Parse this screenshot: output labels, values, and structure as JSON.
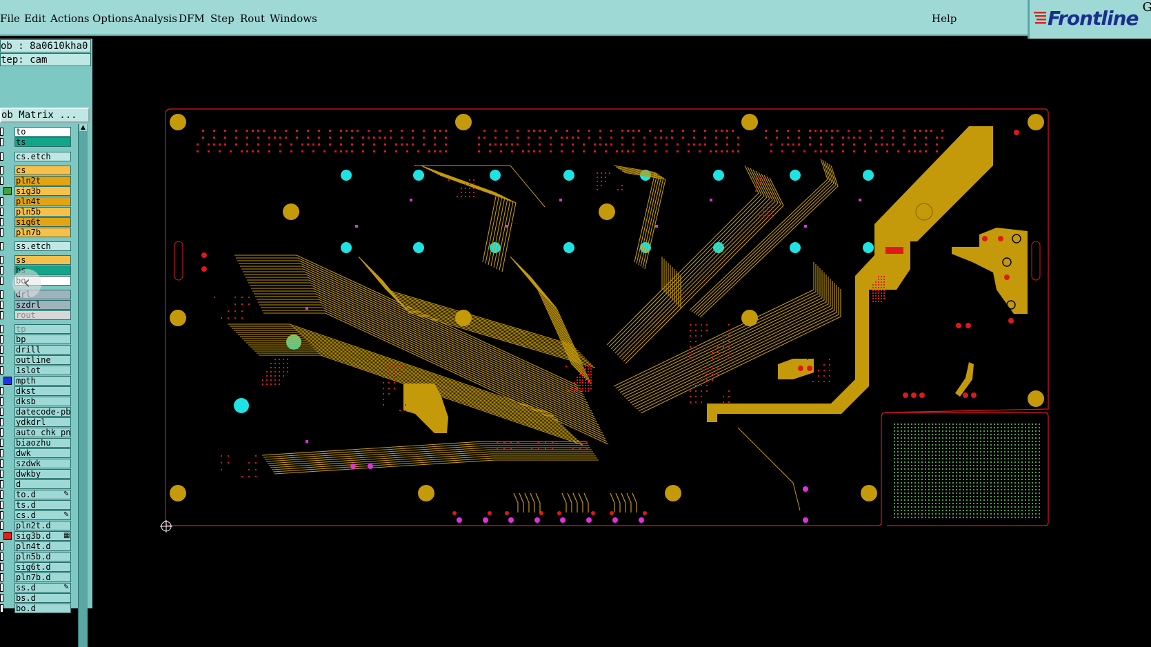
{
  "menubar": {
    "items": [
      "File",
      "Edit",
      "Actions",
      "Options",
      "Analysis",
      "DFM",
      "Step",
      "Rout",
      "Windows"
    ],
    "help": "Help"
  },
  "logo": {
    "text": "Frontline",
    "corner_letter": "G"
  },
  "job": {
    "job_line": "ob : 8a0610kha0",
    "step_line": "tep: cam",
    "matrix_button": "ob Matrix ..."
  },
  "collapse_icon": "chevron-left-icon",
  "layers": [
    {
      "name": "to",
      "color": "#ffffff",
      "sq": "#ffffff"
    },
    {
      "name": "ts",
      "color": "#13a58a",
      "sq": "#ffffff"
    },
    {
      "name": "cs.etch",
      "color": "#bfe8e4",
      "sq": "#ffffff"
    },
    {
      "name": "cs",
      "color": "#f7c04a",
      "sq": "#ffffff"
    },
    {
      "name": "pln2t",
      "color": "#e2a413",
      "sq": "#ffffff"
    },
    {
      "name": "sig3b",
      "color": "#f7c04a",
      "sq": "#3ea33a"
    },
    {
      "name": "pln4t",
      "color": "#e2a413",
      "sq": "#ffffff"
    },
    {
      "name": "pln5b",
      "color": "#f7c04a",
      "sq": "#ffffff"
    },
    {
      "name": "sig6t",
      "color": "#e2a413",
      "sq": "#ffffff"
    },
    {
      "name": "pln7b",
      "color": "#f7c04a",
      "sq": "#ffffff"
    },
    {
      "name": "ss.etch",
      "color": "#bfe8e4",
      "sq": "#ffffff"
    },
    {
      "name": "ss",
      "color": "#f7c04a",
      "sq": "#ffffff"
    },
    {
      "name": "bs",
      "color": "#13a58a",
      "sq": "#ffffff"
    },
    {
      "name": "bo",
      "color": "#ffffff",
      "sq": "#ffffff"
    },
    {
      "name": "drl",
      "color": "#9eb4bd",
      "sq": "#ffffff"
    },
    {
      "name": "szdrl",
      "color": "#9eb4bd",
      "sq": "#ffffff"
    },
    {
      "name": "rout",
      "color": "#d7d7d7",
      "sq": "#ffffff"
    },
    {
      "name": "tp",
      "color": "#9fd9d6",
      "sq": "#ffffff"
    },
    {
      "name": "bp",
      "color": "#9fd9d6",
      "sq": "#ffffff"
    },
    {
      "name": "drill",
      "color": "#9fd9d6",
      "sq": "#ffffff"
    },
    {
      "name": "outline",
      "color": "#9fd9d6",
      "sq": "#ffffff"
    },
    {
      "name": "1slot",
      "color": "#9fd9d6",
      "sq": "#ffffff"
    },
    {
      "name": "mpth",
      "color": "#9fd9d6",
      "sq": "#2233ee"
    },
    {
      "name": "dkst",
      "color": "#9fd9d6",
      "sq": "#ffffff"
    },
    {
      "name": "dksb",
      "color": "#9fd9d6",
      "sq": "#ffffff"
    },
    {
      "name": "datecode-pbc",
      "color": "#9fd9d6",
      "sq": "#ffffff"
    },
    {
      "name": "ydkdrl",
      "color": "#9fd9d6",
      "sq": "#ffffff"
    },
    {
      "name": "auto_chk_pnl",
      "color": "#9fd9d6",
      "sq": "#ffffff"
    },
    {
      "name": "biaozhu",
      "color": "#9fd9d6",
      "sq": "#ffffff"
    },
    {
      "name": "dwk",
      "color": "#9fd9d6",
      "sq": "#ffffff"
    },
    {
      "name": "szdwk",
      "color": "#9fd9d6",
      "sq": "#ffffff"
    },
    {
      "name": "dwkby",
      "color": "#9fd9d6",
      "sq": "#ffffff"
    },
    {
      "name": "d",
      "color": "#9fd9d6",
      "sq": "#ffffff"
    },
    {
      "name": "to.d",
      "color": "#9fd9d6",
      "sq": "#ffffff",
      "mark": "✎"
    },
    {
      "name": "ts.d",
      "color": "#9fd9d6",
      "sq": "#ffffff"
    },
    {
      "name": "cs.d",
      "color": "#9fd9d6",
      "sq": "#ffffff",
      "mark": "✎"
    },
    {
      "name": "pln2t.d",
      "color": "#9fd9d6",
      "sq": "#ffffff"
    },
    {
      "name": "sig3b.d",
      "color": "#9fd9d6",
      "sq": "#e02020",
      "mark": "▦"
    },
    {
      "name": "pln4t.d",
      "color": "#9fd9d6",
      "sq": "#ffffff"
    },
    {
      "name": "pln5b.d",
      "color": "#9fd9d6",
      "sq": "#ffffff"
    },
    {
      "name": "sig6t.d",
      "color": "#9fd9d6",
      "sq": "#ffffff"
    },
    {
      "name": "pln7b.d",
      "color": "#9fd9d6",
      "sq": "#ffffff"
    },
    {
      "name": "ss.d",
      "color": "#9fd9d6",
      "sq": "#ffffff",
      "mark": "✎"
    },
    {
      "name": "bs.d",
      "color": "#9fd9d6",
      "sq": "#ffffff"
    },
    {
      "name": "bo.d",
      "color": "#9fd9d6",
      "sq": "#ffffff"
    }
  ]
}
